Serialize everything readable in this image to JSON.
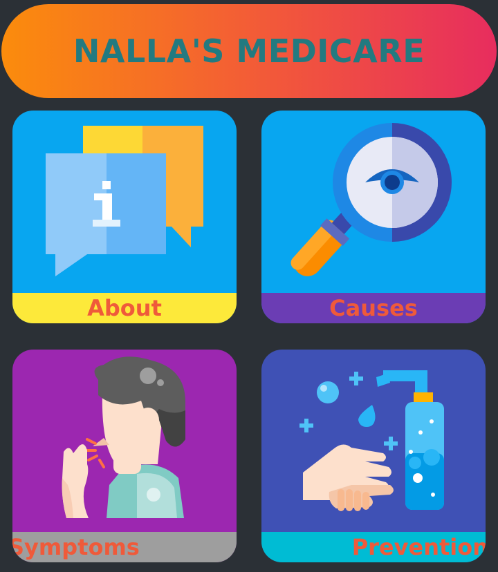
{
  "header": {
    "title": "NALLA'S MEDICARE"
  },
  "cards": [
    {
      "label": "About",
      "icon": "info-chat-icon"
    },
    {
      "label": "Causes",
      "icon": "magnifier-eye-icon"
    },
    {
      "label": "Symptoms",
      "icon": "coughing-person-icon"
    },
    {
      "label": "Prevention",
      "icon": "hand-wash-icon"
    }
  ],
  "colors": {
    "background": "#2b3036",
    "header_gradient": [
      "#fb8c0c",
      "#e72d5e"
    ],
    "header_text": "#237a80",
    "label_text": "#ef5a3a"
  }
}
